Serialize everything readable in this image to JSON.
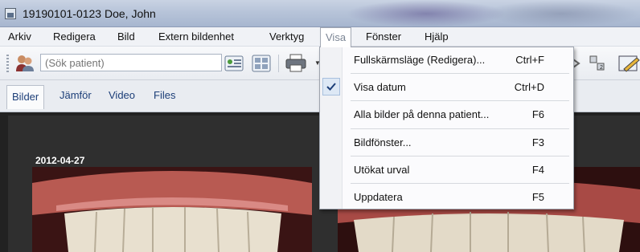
{
  "window": {
    "title": "19190101-0123 Doe, John"
  },
  "menubar": {
    "items": [
      "Arkiv",
      "Redigera",
      "Bild",
      "Extern bildenhet",
      "Verktyg",
      "Visa",
      "Fönster",
      "Hjälp"
    ],
    "active": "Visa"
  },
  "toolbar": {
    "search_placeholder": "(Sök patient)"
  },
  "tabs": [
    "Bilder",
    "Jämför",
    "Video",
    "Files"
  ],
  "selected_tab": "Bilder",
  "content": {
    "date_label": "2012-04-27"
  },
  "visa_menu": {
    "items": [
      {
        "label": "Fullskärmsläge (Redigera)...",
        "shortcut": "Ctrl+F",
        "checked": false
      },
      {
        "label": "Visa datum",
        "shortcut": "Ctrl+D",
        "checked": true
      },
      {
        "label": "Alla bilder på denna patient...",
        "shortcut": "F6",
        "checked": false
      },
      {
        "label": "Bildfönster...",
        "shortcut": "F3",
        "checked": false
      },
      {
        "label": "Utökat urval",
        "shortcut": "F4",
        "checked": false
      },
      {
        "label": "Uppdatera",
        "shortcut": "F5",
        "checked": false
      }
    ]
  },
  "colors": {
    "accent": "#1c3e78",
    "menu_highlight": "#dde8f5",
    "title_bar": "#b7c4d9"
  }
}
